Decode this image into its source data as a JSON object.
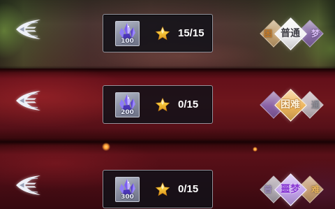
{
  "icons": {
    "row_emblem": "emblem-icon",
    "reward_item": "crystal-icon",
    "progress": "star-icon"
  },
  "rows": [
    {
      "reward": {
        "amount": "100"
      },
      "progress": "15/15",
      "difficulty": {
        "left": {
          "label": "困",
          "fill": "#d8b07a",
          "text_color": "#c27726"
        },
        "current": {
          "label": "普通",
          "fill": "#f2f2f4",
          "text_color": "#3c3c44",
          "outline": "#ffffff"
        },
        "right": {
          "label": "梦",
          "fill": "#8e6cb8",
          "text_color": "#d8bcf6"
        }
      }
    },
    {
      "reward": {
        "amount": "200"
      },
      "progress": "0/15",
      "difficulty": {
        "left": {
          "fill": "#8e6cb8"
        },
        "current": {
          "label": "困难",
          "fill": "#edb45a",
          "text_color": "#fff4dc",
          "outline": "#9a5a1a"
        },
        "right": {
          "label": "通",
          "fill": "#cfcfd4",
          "text_color": "#8a8a94"
        }
      }
    },
    {
      "reward": {
        "amount": "300"
      },
      "progress": "0/15",
      "difficulty": {
        "left": {
          "label": "普",
          "fill": "#bdbdc6",
          "text_color": "#9a8ab8"
        },
        "current": {
          "label": "噩梦",
          "fill": "#c2a2ea",
          "text_color": "#8838d2",
          "outline": "#f4eaff"
        },
        "right": {
          "label": "难",
          "fill": "#d8b07a",
          "text_color": "#e8b45a"
        }
      }
    }
  ]
}
